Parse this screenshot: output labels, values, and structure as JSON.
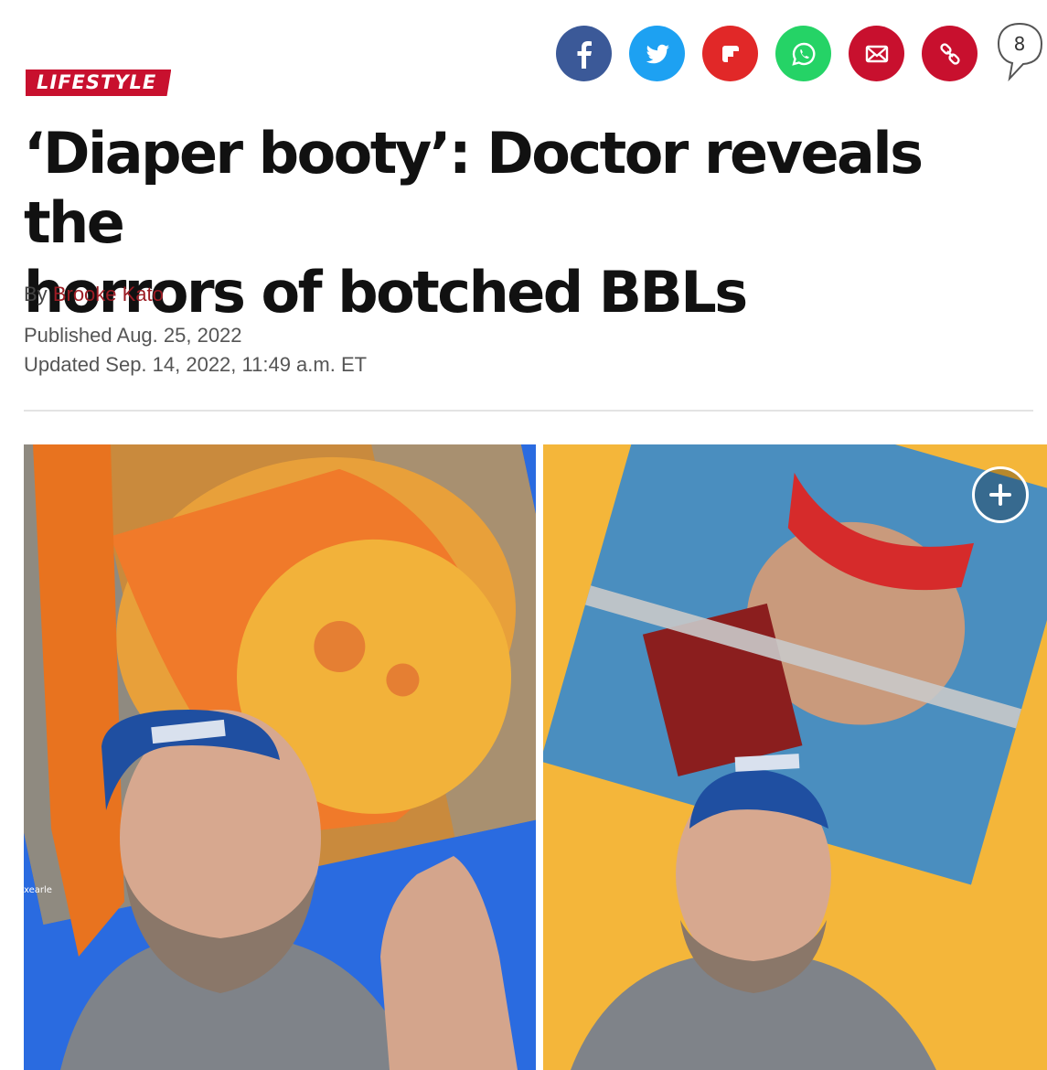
{
  "share": {
    "icons": [
      "facebook-icon",
      "twitter-icon",
      "flipboard-icon",
      "whatsapp-icon",
      "email-icon",
      "link-icon"
    ],
    "colors": {
      "facebook": "#3b5998",
      "twitter": "#1da1f2",
      "flipboard": "#e12828",
      "whatsapp": "#25d366",
      "email": "#c8102e",
      "link": "#c8102e"
    }
  },
  "comments": {
    "count": "8"
  },
  "article": {
    "section": "LIFESTYLE",
    "headline_line1": "‘Diaper booty’: Doctor reveals the",
    "headline_line2": "horrors of botched BBLs",
    "byline_prefix": "By",
    "author": "Brooke Kato",
    "published": "Published Aug. 25, 2022",
    "updated": "Updated Sep. 14, 2022, 11:49 a.m. ET"
  },
  "media": {
    "left_caption": "xearle",
    "accent_color": "#c8102e"
  }
}
